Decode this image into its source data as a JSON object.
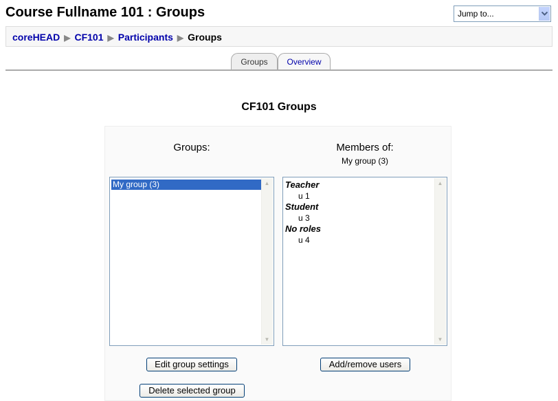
{
  "header": {
    "title": "Course Fullname 101 : Groups"
  },
  "jump_to": {
    "value": "Jump to..."
  },
  "breadcrumb": {
    "items": [
      {
        "label": "coreHEAD"
      },
      {
        "label": "CF101"
      },
      {
        "label": "Participants"
      },
      {
        "label": "Groups"
      }
    ],
    "separator": "▶"
  },
  "tabs": [
    {
      "label": "Groups",
      "active": true
    },
    {
      "label": "Overview",
      "active": false
    }
  ],
  "main": {
    "heading": "CF101 Groups",
    "groups_column": {
      "title": "Groups:",
      "options": [
        {
          "label": "My group (3)",
          "selected": true
        }
      ]
    },
    "members_column": {
      "title": "Members of:",
      "subtitle": "My group (3)",
      "roles": [
        {
          "role": "Teacher",
          "members": [
            "u 1"
          ]
        },
        {
          "role": "Student",
          "members": [
            "u 3"
          ]
        },
        {
          "role": "No roles",
          "members": [
            "u 4"
          ]
        }
      ]
    },
    "buttons": {
      "edit_group_settings": "Edit group settings",
      "add_remove_users": "Add/remove users",
      "delete_selected_group": "Delete selected group"
    }
  },
  "colors": {
    "link": "#0000aa",
    "selection": "#316ac5",
    "tab_border": "#aaaaaa"
  }
}
